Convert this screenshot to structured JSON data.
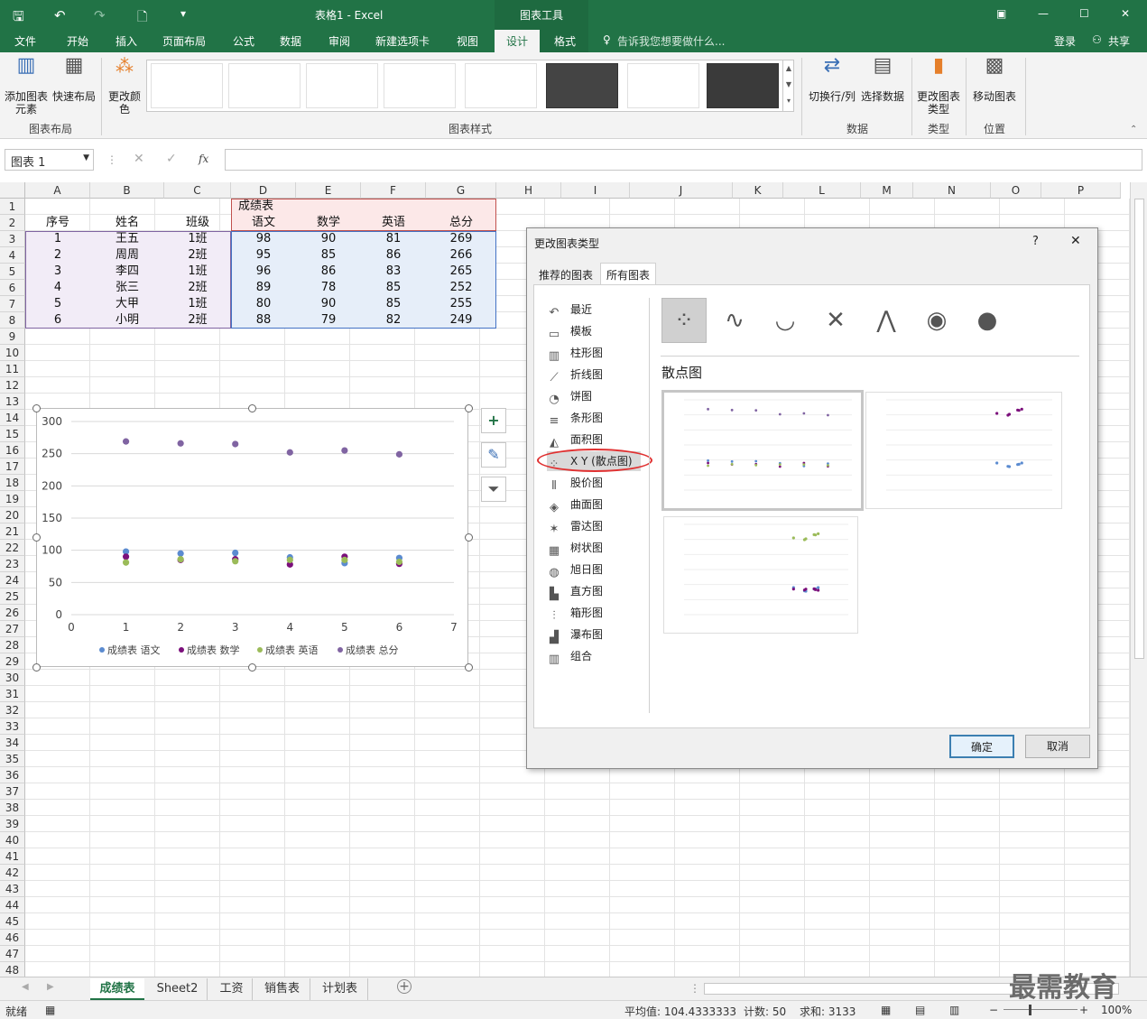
{
  "window": {
    "title": "表格1 - Excel",
    "tools_title": "图表工具"
  },
  "ribbon_tabs": [
    "文件",
    "开始",
    "插入",
    "页面布局",
    "公式",
    "数据",
    "审阅",
    "新建选项卡",
    "视图",
    "设计",
    "格式"
  ],
  "tellme": "告诉我您想要做什么...",
  "login": "登录",
  "share": "共享",
  "ribbon": {
    "add_element": "添加图表元素",
    "quick_layout": "快速布局",
    "change_color": "更改颜色",
    "group_layout": "图表布局",
    "group_style": "图表样式",
    "switch_rowcol": "切换行/列",
    "select_data": "选择数据",
    "group_data": "数据",
    "change_type": "更改图表类型",
    "group_type": "类型",
    "move_chart": "移动图表",
    "group_location": "位置"
  },
  "namebox": "图表 1",
  "fx": "fx",
  "columns": [
    "A",
    "B",
    "C",
    "D",
    "E",
    "F",
    "G",
    "H",
    "I",
    "J",
    "K",
    "L",
    "M",
    "N",
    "O",
    "P"
  ],
  "rows": [
    "1",
    "2",
    "3",
    "4",
    "5",
    "6",
    "7",
    "8",
    "9",
    "10",
    "11",
    "12",
    "13",
    "14",
    "15",
    "16",
    "17",
    "18",
    "19",
    "20",
    "21",
    "22",
    "23",
    "24",
    "25",
    "26",
    "27",
    "28",
    "29",
    "30",
    "31",
    "32",
    "33",
    "34",
    "35",
    "36",
    "37",
    "38",
    "39",
    "40",
    "41",
    "42",
    "43",
    "44",
    "45",
    "46",
    "47",
    "48"
  ],
  "table": {
    "merged_title": "成绩表",
    "headers": [
      "序号",
      "姓名",
      "班级",
      "语文",
      "数学",
      "英语",
      "总分"
    ],
    "rows": [
      [
        "1",
        "王五",
        "1班",
        "98",
        "90",
        "81",
        "269"
      ],
      [
        "2",
        "周周",
        "2班",
        "95",
        "85",
        "86",
        "266"
      ],
      [
        "3",
        "李四",
        "1班",
        "96",
        "86",
        "83",
        "265"
      ],
      [
        "4",
        "张三",
        "2班",
        "89",
        "78",
        "85",
        "252"
      ],
      [
        "5",
        "大甲",
        "1班",
        "80",
        "90",
        "85",
        "255"
      ],
      [
        "6",
        "小明",
        "2班",
        "88",
        "79",
        "82",
        "249"
      ]
    ]
  },
  "chart_data": {
    "type": "scatter",
    "title": "",
    "x": [
      1,
      2,
      3,
      4,
      5,
      6
    ],
    "xlim": [
      0,
      7
    ],
    "ylim": [
      0,
      300
    ],
    "xticks": [
      "0",
      "1",
      "2",
      "3",
      "4",
      "5",
      "6",
      "7"
    ],
    "yticks": [
      "0",
      "50",
      "100",
      "150",
      "200",
      "250",
      "300"
    ],
    "grid": true,
    "legend": "bottom",
    "series": [
      {
        "name": "成绩表 语文",
        "color": "#5b8bd0",
        "values": [
          98,
          95,
          96,
          89,
          80,
          88
        ]
      },
      {
        "name": "成绩表 数学",
        "color": "#7b0f7b",
        "values": [
          90,
          85,
          86,
          78,
          90,
          79
        ]
      },
      {
        "name": "成绩表 英语",
        "color": "#9bbb59",
        "values": [
          81,
          86,
          83,
          85,
          85,
          82
        ]
      },
      {
        "name": "成绩表 总分",
        "color": "#8064a2",
        "values": [
          269,
          266,
          265,
          252,
          255,
          249
        ]
      }
    ]
  },
  "dialog": {
    "title": "更改图表类型",
    "help": "?",
    "close": "✕",
    "tabs": [
      "推荐的图表",
      "所有图表"
    ],
    "list": [
      "最近",
      "模板",
      "柱形图",
      "折线图",
      "饼图",
      "条形图",
      "面积图",
      "X Y (散点图)",
      "股价图",
      "曲面图",
      "雷达图",
      "树状图",
      "旭日图",
      "直方图",
      "箱形图",
      "瀑布图",
      "组合"
    ],
    "selected_index": 7,
    "subtype_title": "散点图",
    "ok": "确定",
    "cancel": "取消"
  },
  "sheets": [
    "成绩表",
    "Sheet2",
    "工资",
    "销售表",
    "计划表"
  ],
  "active_sheet": 0,
  "status": {
    "ready": "就绪",
    "avg": "平均值: 104.4333333",
    "count": "计数: 50",
    "sum": "求和: 3133",
    "zoom": "100%"
  },
  "watermark": "最需教育"
}
